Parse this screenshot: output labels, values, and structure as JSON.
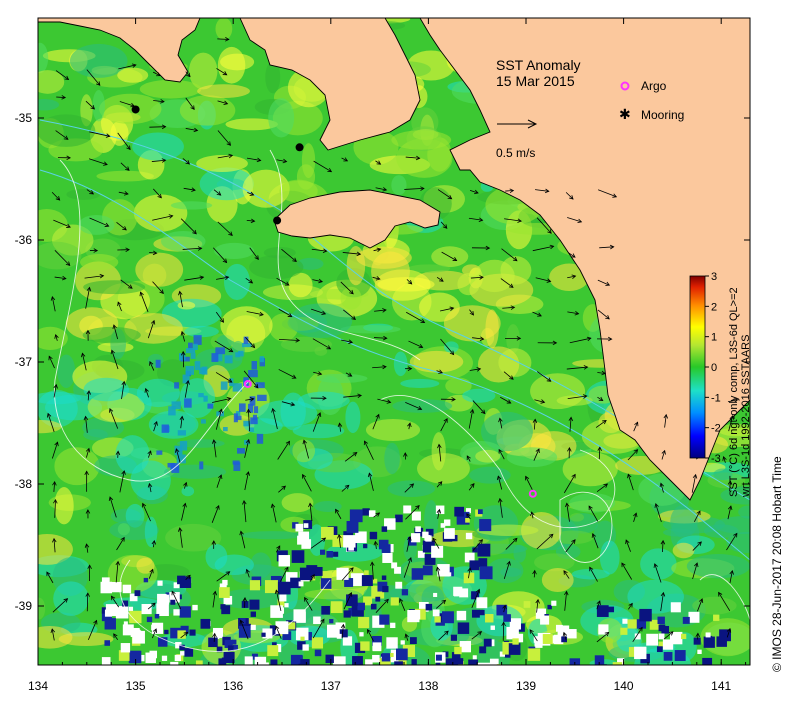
{
  "map": {
    "title": "SST Anomaly",
    "date": "15 Mar 2015",
    "x_ticks": [
      "134",
      "135",
      "136",
      "137",
      "138",
      "139",
      "140",
      "141"
    ],
    "y_ticks": [
      "-35",
      "-36",
      "-37",
      "-38",
      "-39"
    ],
    "land_color": "#fbc89d",
    "ocean_base_color": "#3cc832"
  },
  "legend": {
    "argo_label": "Argo",
    "mooring_label": "Mooring",
    "argo_color": "#ff33ff",
    "scale_label": "0.5 m/s"
  },
  "colorbar": {
    "ticks": [
      "3",
      "2",
      "1",
      "0",
      "-1",
      "-2",
      "-3"
    ],
    "title_line1": "SST (°C) 6d ngt-only comp, L3S-6d QL>=2",
    "title_line2": "wrt L3S-1d 1992-2016 SSTAARS"
  },
  "credit": "© IMOS 28-Jun-2017 20:08 Hobart Time"
}
